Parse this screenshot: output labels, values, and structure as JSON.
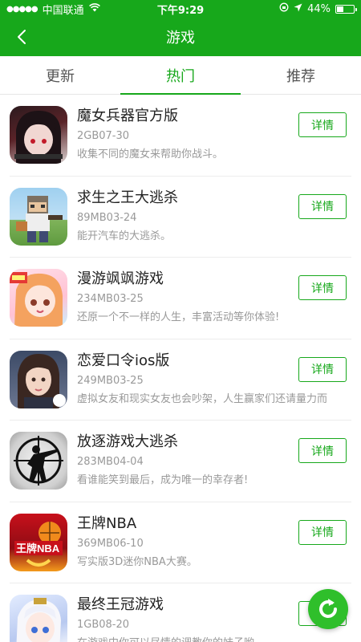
{
  "status_bar": {
    "carrier": "中国联通",
    "time": "下午9:29",
    "battery": "44%",
    "battery_level": 0.44
  },
  "navbar": {
    "title": "游戏"
  },
  "tabs": [
    {
      "label": "更新",
      "active": false
    },
    {
      "label": "热门",
      "active": true
    },
    {
      "label": "推荐",
      "active": false
    }
  ],
  "apps": [
    {
      "name": "魔女兵器官方版",
      "size": "2GB07-30",
      "desc": "收集不同的魔女来帮助你战斗。",
      "button": "详情"
    },
    {
      "name": "求生之王大逃杀",
      "size": "89MB03-24",
      "desc": "能开汽车的大逃杀。",
      "button": "详情"
    },
    {
      "name": "漫游飒飒游戏",
      "size": "234MB03-25",
      "desc": "还原一个不一样的人生，丰富活动等你体验!",
      "button": "详情"
    },
    {
      "name": "恋爱口令ios版",
      "size": "249MB03-25",
      "desc": "虚拟女友和现实女友也会吵架，人生赢家们还请量力而",
      "button": "详情"
    },
    {
      "name": "放逐游戏大逃杀",
      "size": "283MB04-04",
      "desc": "看谁能笑到最后，成为唯一的幸存者!",
      "button": "详情"
    },
    {
      "name": "王牌NBA",
      "size": "369MB06-10",
      "desc": "写实版3D迷你NBA大赛。",
      "button": "详情"
    },
    {
      "name": "最终王冠游戏",
      "size": "1GB08-20",
      "desc": "在游戏中你可以尽情的调教你的妹子哟",
      "button": "详情"
    }
  ],
  "icons": {
    "back": "chevron-left-icon",
    "refresh": "refresh-icon"
  },
  "colors": {
    "brand_green": "#17a81b",
    "text_gray": "#999999"
  }
}
